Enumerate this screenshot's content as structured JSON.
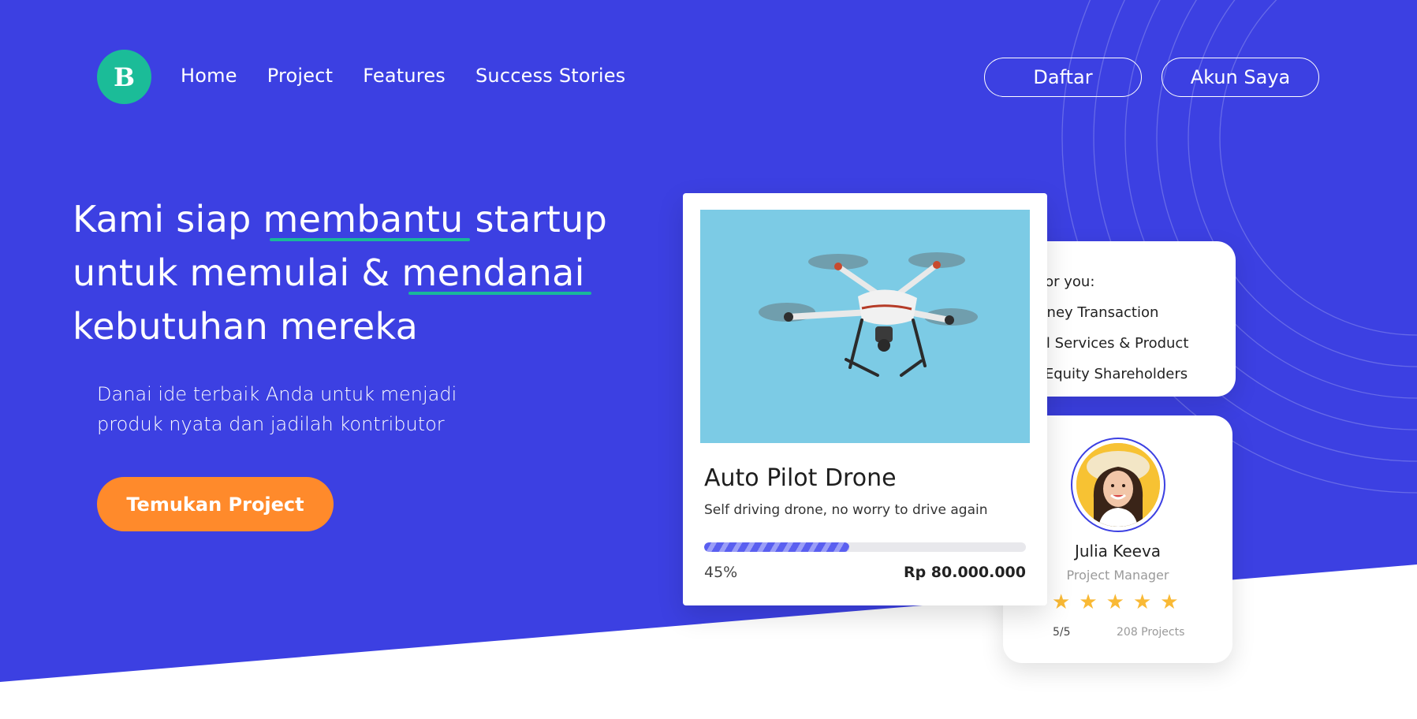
{
  "nav": {
    "logo_letter": "B",
    "links": [
      "Home",
      "Project",
      "Features",
      "Success Stories"
    ],
    "register_label": "Daftar",
    "account_label": "Akun Saya"
  },
  "hero": {
    "line1_pre": "Kami siap ",
    "line1_em": "membantu",
    "line1_post": " startup",
    "line2_pre": "untuk memulai & ",
    "line2_em": "mendanai",
    "line3": "kebutuhan mereka",
    "sub_line1": "Danai ide terbaik Anda untuk menjadi",
    "sub_line2": "produk nyata dan jadilah kontributor",
    "cta_label": "Temukan Project"
  },
  "benefits": {
    "title": "it for you:",
    "items": [
      "Money Transaction",
      "cial Services & Product",
      "te Equity Shareholders"
    ]
  },
  "profile": {
    "name": "Julia Keeva",
    "role": "Project Manager",
    "stars": 5,
    "rating": "5/5",
    "projects": "208 Projects"
  },
  "project": {
    "title": "Auto Pilot Drone",
    "description": "Self driving drone, no worry to drive again",
    "progress": 0.45,
    "progress_label": "45%",
    "amount": "Rp 80.000.000"
  },
  "colors": {
    "hero_bg": "#3c40e2",
    "accent_green": "#19b89a",
    "cta_orange": "#ff8a2b",
    "star": "#f9b935",
    "progress": "#5a5ff0"
  }
}
